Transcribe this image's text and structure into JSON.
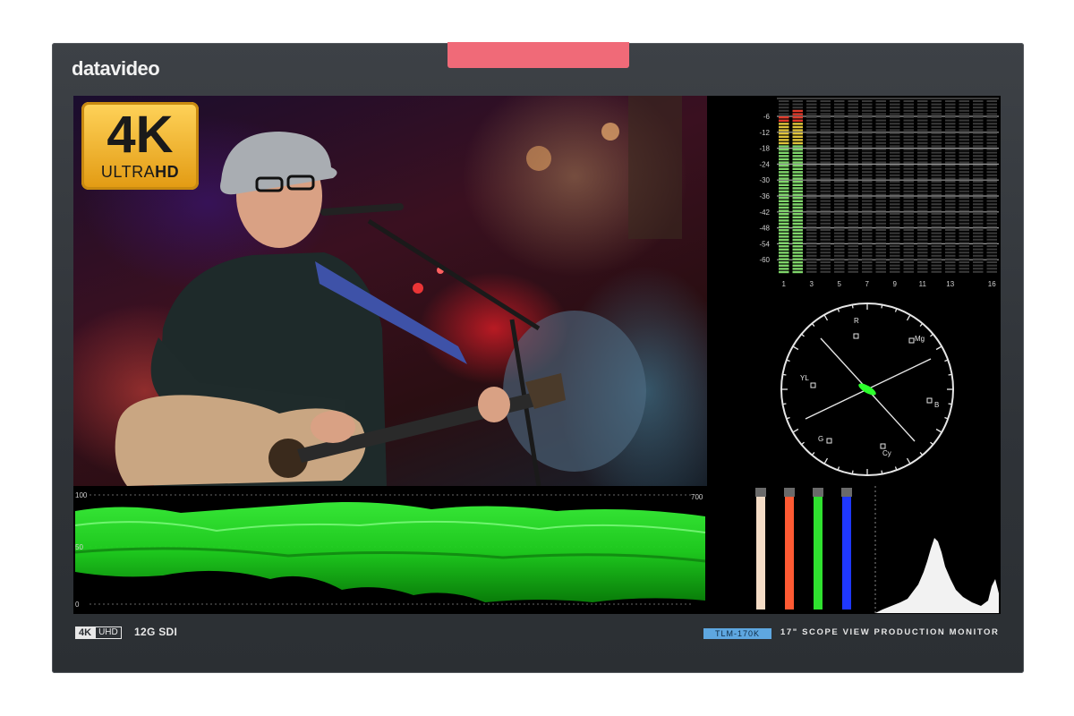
{
  "monitor": {
    "brand": "datavideo",
    "badge": {
      "main": "4K",
      "sub_light": "ULTRA",
      "sub_bold": "HD"
    },
    "spec_labels": {
      "k4": "4K",
      "uhd": "UHD",
      "sdi": "12G SDI"
    },
    "model_tag": "TLM-170K",
    "model_desc": "17\" SCOPE VIEW PRODUCTION MONITOR",
    "colors": {
      "bezel": "#2f3338",
      "tally": "#f06a78",
      "model_tag": "#5ea7e0",
      "scope_green": "#2cff2c"
    }
  },
  "audio_meter": {
    "db_scale": [
      "-6",
      "-12",
      "-18",
      "-24",
      "-30",
      "-36",
      "-42",
      "-48",
      "-54",
      "-60"
    ],
    "channel_labels": [
      "1",
      "3",
      "5",
      "7",
      "9",
      "11",
      "13",
      "16"
    ],
    "levels_db": [
      -8,
      -6
    ]
  },
  "vectorscope": {
    "targets": [
      "R",
      "Mg",
      "YL",
      "B",
      "G",
      "Cy"
    ]
  },
  "waveform": {
    "scale_left": [
      "100",
      "50",
      "0"
    ],
    "scale_right": "700"
  },
  "rgb_bars": {
    "colors": [
      "#f4dcc6",
      "#ff5a33",
      "#2fe12f",
      "#1f38ff"
    ]
  },
  "video": {
    "description_icon": "performer-video-feed"
  }
}
